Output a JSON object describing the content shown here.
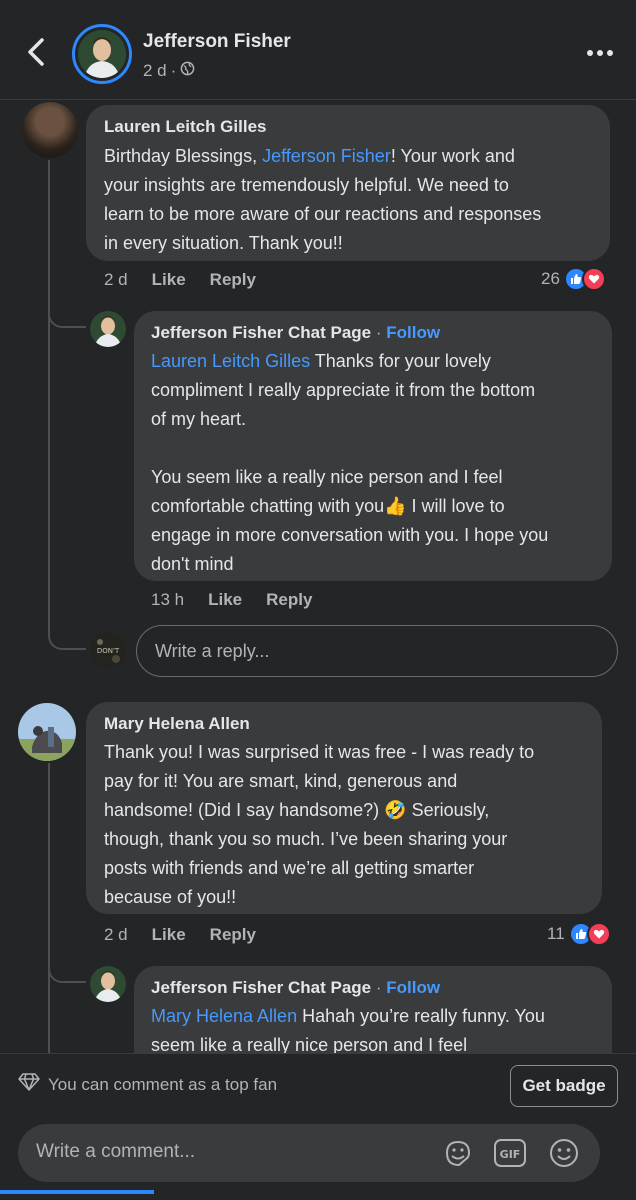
{
  "header": {
    "name": "Jefferson Fisher",
    "time": "2 d",
    "separator": "·"
  },
  "comments": [
    {
      "name": "Lauren Leitch Gilles",
      "text_before": "Birthday Blessings, ",
      "mention": "Jefferson Fisher",
      "text_lines_after": [
        "! Your work and",
        "your insights are tremendously helpful. We need to",
        "learn to be more aware of our reactions and responses",
        "in every situation. Thank you!!"
      ],
      "time": "2 d",
      "like_label": "Like",
      "reply_label": "Reply",
      "reaction_count": "26"
    },
    {
      "name": "Jefferson Fisher Chat Page",
      "separator": "·",
      "follow_label": "Follow",
      "mention": "Lauren Leitch Gilles",
      "line1_after": " Thanks for your lovely",
      "line2": "compliment I really appreciate it from the bottom",
      "line3": "of my heart.",
      "line4": "You seem like a really nice person and I feel",
      "line5": "comfortable chatting with you",
      "line5_emoji": "👍",
      "line5_after": " I will love to",
      "line6": "engage in more conversation with you. I hope you",
      "line7": "don't mind",
      "time": "13 h",
      "like_label": "Like",
      "reply_label": "Reply"
    },
    {
      "name": "Mary Helena Allen",
      "line1": "Thank you! I was surprised it was free - I was ready to",
      "line2": "pay for it! You are smart, kind, generous and",
      "line3_before": "handsome! (Did I say handsome?) ",
      "line3_emoji": "🤣",
      "line3_after": " Seriously,",
      "line4": "though, thank you so much. I’ve been sharing your",
      "line5": "posts with friends and we’re all getting smarter",
      "line6": "because of you!!",
      "time": "2 d",
      "like_label": "Like",
      "reply_label": "Reply",
      "reaction_count": "11"
    },
    {
      "name": "Jefferson Fisher Chat Page",
      "separator": "·",
      "follow_label": "Follow",
      "mention": "Mary Helena Allen",
      "line1_after": " Hahah you’re really funny. You",
      "line2": "seem like a really nice person and I feel"
    }
  ],
  "reply_input": {
    "placeholder": "Write a reply..."
  },
  "avatar_caption": "DON'T",
  "bottom": {
    "fan_text": "You can comment as a top fan",
    "badge_label": "Get badge",
    "comment_placeholder": "Write a comment...",
    "gif_label": "GIF"
  },
  "colors": {
    "background": "#242526",
    "bubble": "#3a3b3c",
    "link": "#4599ff",
    "like_blue": "#2d88ff",
    "love_red": "#f33e58"
  },
  "icons": [
    "back-arrow-icon",
    "globe-icon",
    "more-dots-icon",
    "like-reaction-icon",
    "love-reaction-icon",
    "diamond-icon",
    "sticker-icon",
    "gif-icon",
    "emoji-icon"
  ]
}
